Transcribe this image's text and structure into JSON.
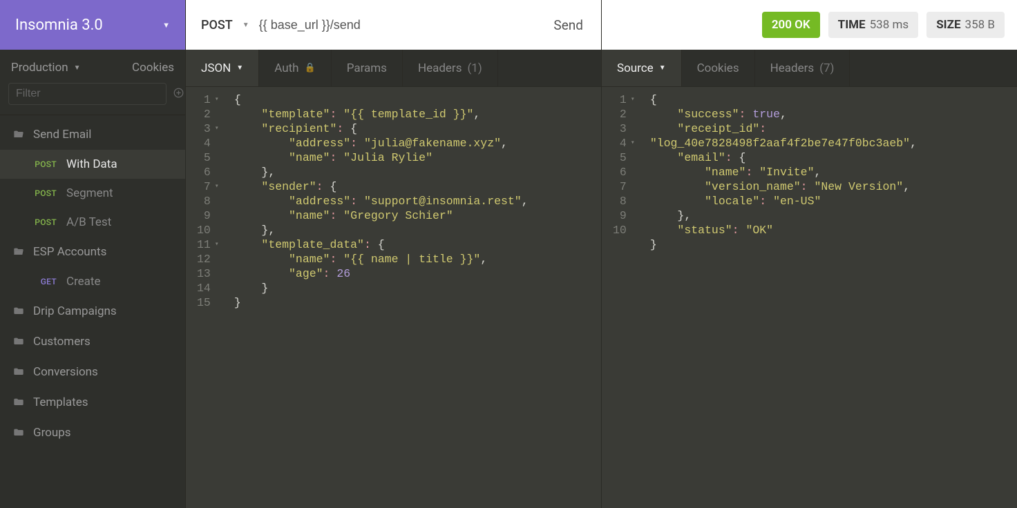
{
  "workspace": {
    "name": "Insomnia 3.0"
  },
  "sidebar": {
    "environment": "Production",
    "cookies_label": "Cookies",
    "filter_placeholder": "Filter",
    "tree": [
      {
        "type": "folder",
        "open": true,
        "name": "Send Email"
      },
      {
        "type": "request",
        "method": "POST",
        "name": "With Data",
        "active": true
      },
      {
        "type": "request",
        "method": "POST",
        "name": "Segment"
      },
      {
        "type": "request",
        "method": "POST",
        "name": "A/B Test"
      },
      {
        "type": "folder",
        "open": true,
        "name": "ESP Accounts"
      },
      {
        "type": "request",
        "method": "GET",
        "name": "Create"
      },
      {
        "type": "folder",
        "open": false,
        "name": "Drip Campaigns"
      },
      {
        "type": "folder",
        "open": false,
        "name": "Customers"
      },
      {
        "type": "folder",
        "open": false,
        "name": "Conversions"
      },
      {
        "type": "folder",
        "open": false,
        "name": "Templates"
      },
      {
        "type": "folder",
        "open": false,
        "name": "Groups"
      }
    ]
  },
  "request": {
    "method": "POST",
    "url": "{{ base_url }}/send",
    "send_label": "Send",
    "tabs": {
      "body_label": "JSON",
      "auth_label": "Auth",
      "params_label": "Params",
      "headers_label": "Headers",
      "headers_count": "(1)"
    },
    "body_lines": [
      {
        "n": 1,
        "fold": true,
        "indent": 0,
        "tokens": [
          {
            "t": "punc",
            "v": "{"
          }
        ]
      },
      {
        "n": 2,
        "fold": false,
        "indent": 1,
        "tokens": [
          {
            "t": "key",
            "v": "\"template\""
          },
          {
            "t": "col",
            "v": ": "
          },
          {
            "t": "str",
            "v": "\"{{ template_id }}\""
          },
          {
            "t": "punc",
            "v": ","
          }
        ]
      },
      {
        "n": 3,
        "fold": true,
        "indent": 1,
        "tokens": [
          {
            "t": "key",
            "v": "\"recipient\""
          },
          {
            "t": "col",
            "v": ": "
          },
          {
            "t": "punc",
            "v": "{"
          }
        ]
      },
      {
        "n": 4,
        "fold": false,
        "indent": 2,
        "tokens": [
          {
            "t": "key",
            "v": "\"address\""
          },
          {
            "t": "col",
            "v": ": "
          },
          {
            "t": "str",
            "v": "\"julia@fakename.xyz\""
          },
          {
            "t": "punc",
            "v": ","
          }
        ]
      },
      {
        "n": 5,
        "fold": false,
        "indent": 2,
        "tokens": [
          {
            "t": "key",
            "v": "\"name\""
          },
          {
            "t": "col",
            "v": ": "
          },
          {
            "t": "str",
            "v": "\"Julia Rylie\""
          }
        ]
      },
      {
        "n": 6,
        "fold": false,
        "indent": 1,
        "tokens": [
          {
            "t": "punc",
            "v": "},"
          }
        ]
      },
      {
        "n": 7,
        "fold": true,
        "indent": 1,
        "tokens": [
          {
            "t": "key",
            "v": "\"sender\""
          },
          {
            "t": "col",
            "v": ": "
          },
          {
            "t": "punc",
            "v": "{"
          }
        ]
      },
      {
        "n": 8,
        "fold": false,
        "indent": 2,
        "tokens": [
          {
            "t": "key",
            "v": "\"address\""
          },
          {
            "t": "col",
            "v": ": "
          },
          {
            "t": "str",
            "v": "\"support@insomnia.rest\""
          },
          {
            "t": "punc",
            "v": ","
          }
        ]
      },
      {
        "n": 9,
        "fold": false,
        "indent": 2,
        "tokens": [
          {
            "t": "key",
            "v": "\"name\""
          },
          {
            "t": "col",
            "v": ": "
          },
          {
            "t": "str",
            "v": "\"Gregory Schier\""
          }
        ]
      },
      {
        "n": 10,
        "fold": false,
        "indent": 1,
        "tokens": [
          {
            "t": "punc",
            "v": "},"
          }
        ]
      },
      {
        "n": 11,
        "fold": true,
        "indent": 1,
        "tokens": [
          {
            "t": "key",
            "v": "\"template_data\""
          },
          {
            "t": "col",
            "v": ": "
          },
          {
            "t": "punc",
            "v": "{"
          }
        ]
      },
      {
        "n": 12,
        "fold": false,
        "indent": 2,
        "tokens": [
          {
            "t": "key",
            "v": "\"name\""
          },
          {
            "t": "col",
            "v": ": "
          },
          {
            "t": "str",
            "v": "\"{{ name | title }}\""
          },
          {
            "t": "punc",
            "v": ","
          }
        ]
      },
      {
        "n": 13,
        "fold": false,
        "indent": 2,
        "tokens": [
          {
            "t": "key",
            "v": "\"age\""
          },
          {
            "t": "col",
            "v": ": "
          },
          {
            "t": "num",
            "v": "26"
          }
        ]
      },
      {
        "n": 14,
        "fold": false,
        "indent": 1,
        "tokens": [
          {
            "t": "punc",
            "v": "}"
          }
        ]
      },
      {
        "n": 15,
        "fold": false,
        "indent": 0,
        "tokens": [
          {
            "t": "punc",
            "v": "}"
          }
        ]
      }
    ]
  },
  "response": {
    "status_text": "200 OK",
    "time_label": "TIME",
    "time_value": "538 ms",
    "size_label": "SIZE",
    "size_value": "358 B",
    "tabs": {
      "source_label": "Source",
      "cookies_label": "Cookies",
      "headers_label": "Headers",
      "headers_count": "(7)"
    },
    "body_lines": [
      {
        "n": 1,
        "fold": true,
        "indent": 0,
        "tokens": [
          {
            "t": "punc",
            "v": "{"
          }
        ]
      },
      {
        "n": 2,
        "fold": false,
        "indent": 1,
        "tokens": [
          {
            "t": "key",
            "v": "\"success\""
          },
          {
            "t": "col",
            "v": ": "
          },
          {
            "t": "bool",
            "v": "true"
          },
          {
            "t": "punc",
            "v": ","
          }
        ]
      },
      {
        "n": 3,
        "fold": false,
        "indent": 1,
        "tokens": [
          {
            "t": "key",
            "v": "\"receipt_id\""
          },
          {
            "t": "col",
            "v": ": "
          }
        ]
      },
      {
        "n": "",
        "fold": false,
        "indent": 0,
        "tokens": [
          {
            "t": "str",
            "v": "\"log_40e7828498f2aaf4f2be7e47f0bc3aeb\""
          },
          {
            "t": "punc",
            "v": ","
          }
        ]
      },
      {
        "n": 4,
        "fold": true,
        "indent": 1,
        "tokens": [
          {
            "t": "key",
            "v": "\"email\""
          },
          {
            "t": "col",
            "v": ": "
          },
          {
            "t": "punc",
            "v": "{"
          }
        ]
      },
      {
        "n": 5,
        "fold": false,
        "indent": 2,
        "tokens": [
          {
            "t": "key",
            "v": "\"name\""
          },
          {
            "t": "col",
            "v": ": "
          },
          {
            "t": "str",
            "v": "\"Invite\""
          },
          {
            "t": "punc",
            "v": ","
          }
        ]
      },
      {
        "n": 6,
        "fold": false,
        "indent": 2,
        "tokens": [
          {
            "t": "key",
            "v": "\"version_name\""
          },
          {
            "t": "col",
            "v": ": "
          },
          {
            "t": "str",
            "v": "\"New Version\""
          },
          {
            "t": "punc",
            "v": ","
          }
        ]
      },
      {
        "n": 7,
        "fold": false,
        "indent": 2,
        "tokens": [
          {
            "t": "key",
            "v": "\"locale\""
          },
          {
            "t": "col",
            "v": ": "
          },
          {
            "t": "str",
            "v": "\"en-US\""
          }
        ]
      },
      {
        "n": 8,
        "fold": false,
        "indent": 1,
        "tokens": [
          {
            "t": "punc",
            "v": "},"
          }
        ]
      },
      {
        "n": 9,
        "fold": false,
        "indent": 1,
        "tokens": [
          {
            "t": "key",
            "v": "\"status\""
          },
          {
            "t": "col",
            "v": ": "
          },
          {
            "t": "str",
            "v": "\"OK\""
          }
        ]
      },
      {
        "n": 10,
        "fold": false,
        "indent": 0,
        "tokens": [
          {
            "t": "punc",
            "v": "}"
          }
        ]
      }
    ]
  }
}
